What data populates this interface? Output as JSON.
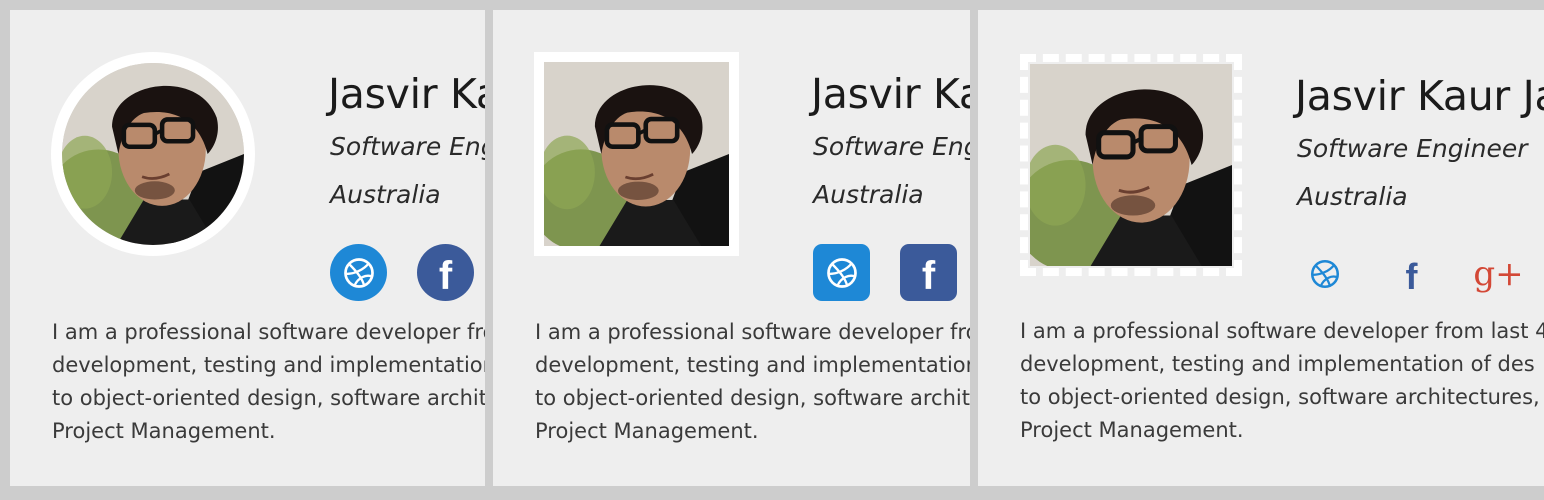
{
  "profile": {
    "name": "Jasvir Kaur Ja",
    "title": "Software Engineer",
    "location": "Australia",
    "bio_lines": [
      "I am a professional software developer from last 4",
      "development, testing and implementation of des",
      "to object-oriented design, software architectures,",
      "Project Management."
    ]
  },
  "cards": [
    {
      "photo_style": "circle-white-border",
      "social_style": "circle-filled"
    },
    {
      "photo_style": "square-white-border",
      "social_style": "rounded-square-filled"
    },
    {
      "photo_style": "square-dashed-border",
      "social_style": "icon-only"
    }
  ],
  "social_icons": [
    {
      "name": "dribbble-icon",
      "color": "#1e88d6"
    },
    {
      "name": "facebook-icon",
      "color": "#3b5a9a",
      "glyph": "f"
    },
    {
      "name": "google-plus-icon",
      "color": "#d34836",
      "glyph": "g+"
    }
  ]
}
